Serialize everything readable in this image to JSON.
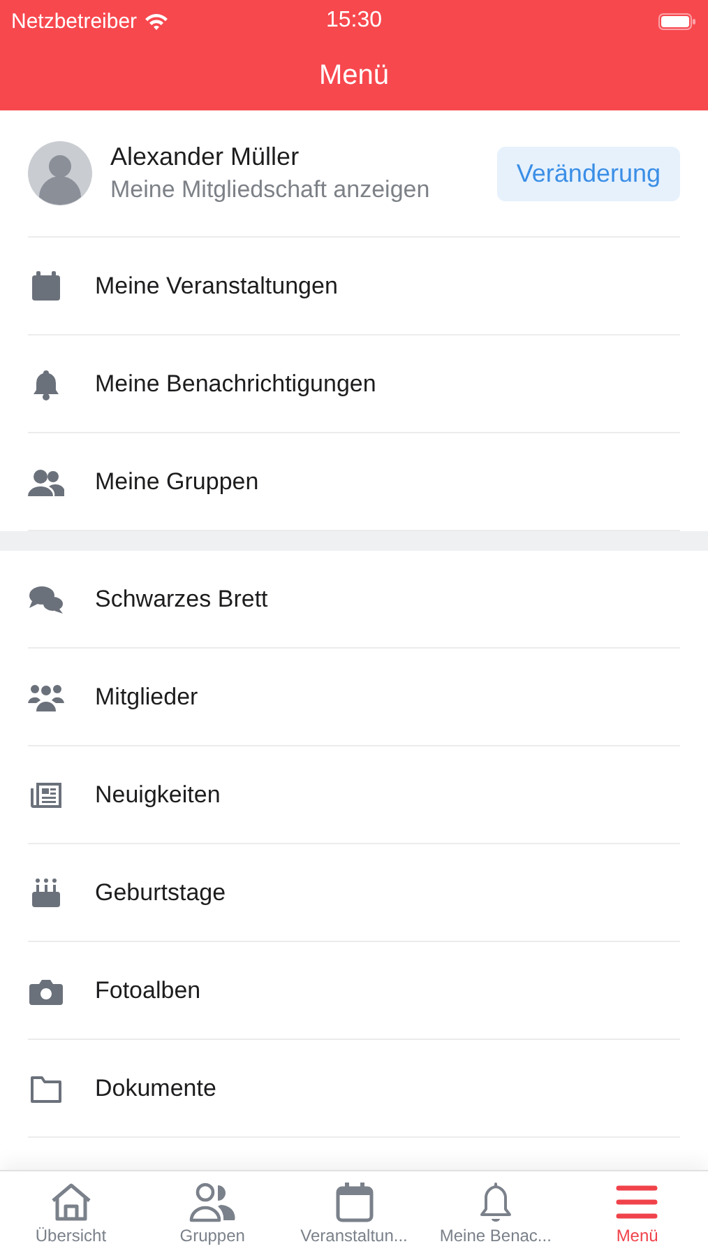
{
  "status_bar": {
    "carrier": "Netzbetreiber",
    "time": "15:30"
  },
  "nav_bar": {
    "title": "Menü"
  },
  "profile": {
    "name": "Alexander Müller",
    "subtitle": "Meine Mitgliedschaft anzeigen",
    "button": "Veränderung"
  },
  "sections": [
    {
      "items": [
        {
          "label": "Meine Veranstaltungen"
        },
        {
          "label": "Meine Benachrichtigungen"
        },
        {
          "label": "Meine Gruppen"
        }
      ]
    },
    {
      "items": [
        {
          "label": "Schwarzes Brett"
        },
        {
          "label": "Mitglieder"
        },
        {
          "label": "Neuigkeiten"
        },
        {
          "label": "Geburtstage"
        },
        {
          "label": "Fotoalben"
        },
        {
          "label": "Dokumente"
        }
      ]
    }
  ],
  "tab_bar": [
    {
      "label": "Übersicht",
      "selected": false
    },
    {
      "label": "Gruppen",
      "selected": false
    },
    {
      "label": "Veranstaltun...",
      "selected": false
    },
    {
      "label": "Meine Benac...",
      "selected": false
    },
    {
      "label": "Menü",
      "selected": true
    }
  ]
}
